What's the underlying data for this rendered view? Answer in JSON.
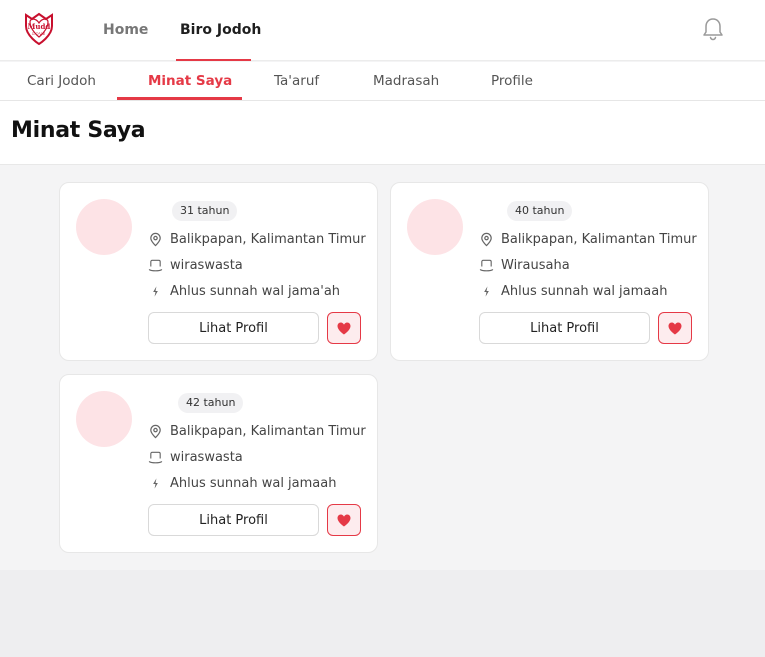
{
  "app": {
    "logo_text": "Mudd",
    "logo_subtext": "LOVE",
    "accent_color": "#e53946"
  },
  "topnav": {
    "items": [
      {
        "label": "Home",
        "active": false
      },
      {
        "label": "Biro Jodoh",
        "active": true
      }
    ],
    "notification_icon": "bell-icon"
  },
  "tabs": {
    "items": [
      {
        "label": "Cari Jodoh",
        "active": false
      },
      {
        "label": "Minat Saya",
        "active": true
      },
      {
        "label": "Ta'aruf",
        "active": false
      },
      {
        "label": "Madrasah",
        "active": false
      },
      {
        "label": "Profile",
        "active": false
      }
    ]
  },
  "page": {
    "title": "Minat Saya"
  },
  "cards": [
    {
      "age": "31 tahun",
      "location": "Balikpapan, Kalimantan Timur",
      "occupation": "wiraswasta",
      "manhaj": "Ahlus sunnah wal jama'ah",
      "profile_button": "Lihat Profil",
      "liked": true
    },
    {
      "age": "40 tahun",
      "location": "Balikpapan, Kalimantan Timur",
      "occupation": "Wirausaha",
      "manhaj": "Ahlus sunnah wal jamaah",
      "profile_button": "Lihat Profil",
      "liked": true
    },
    {
      "age": "42 tahun",
      "location": "Balikpapan, Kalimantan Timur",
      "occupation": "wiraswasta",
      "manhaj": "Ahlus sunnah wal jamaah",
      "profile_button": "Lihat Profil",
      "liked": true
    }
  ]
}
